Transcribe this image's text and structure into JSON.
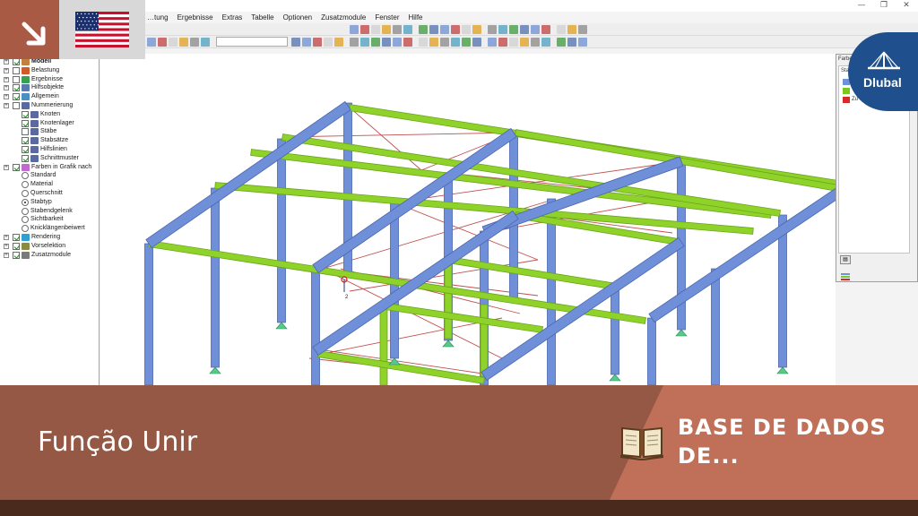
{
  "window": {
    "restore_glyph": "❐",
    "close_glyph": "✕",
    "minimize_glyph": "—"
  },
  "menu": {
    "items": [
      "…tung",
      "Ergebnisse",
      "Extras",
      "Tabelle",
      "Optionen",
      "Zusatzmodule",
      "Fenster",
      "Hilfe"
    ]
  },
  "navigator": {
    "items": [
      {
        "label": "Modell",
        "bold": true,
        "check": "on",
        "icon": "model-icon"
      },
      {
        "label": "Belastung",
        "check": "off",
        "icon": "load-icon"
      },
      {
        "label": "Ergebnisse",
        "check": "off",
        "icon": "results-icon"
      },
      {
        "label": "Hilfsobjekte",
        "check": "on",
        "icon": "guide-objects-icon"
      },
      {
        "label": "Allgemein",
        "check": "on",
        "icon": "general-icon"
      },
      {
        "label": "Nummerierung",
        "check": "off",
        "icon": "numbering-icon"
      },
      {
        "label": "Knoten",
        "check": "on",
        "icon": "numbering-icon"
      },
      {
        "label": "Knotenlager",
        "check": "on",
        "icon": "numbering-icon"
      },
      {
        "label": "Stäbe",
        "check": "off",
        "icon": "numbering-icon"
      },
      {
        "label": "Stabsätze",
        "check": "on",
        "icon": "numbering-icon"
      },
      {
        "label": "Hilfslinien",
        "check": "on",
        "icon": "numbering-icon"
      },
      {
        "label": "Schnittmuster",
        "check": "on",
        "icon": "numbering-icon"
      },
      {
        "label": "Farben in Grafik nach",
        "check": "on",
        "icon": "colors-icon"
      },
      {
        "label": "Standard",
        "radio": "off"
      },
      {
        "label": "Material",
        "radio": "off"
      },
      {
        "label": "Querschnitt",
        "radio": "off"
      },
      {
        "label": "Stabtyp",
        "radio": "on"
      },
      {
        "label": "Stabendgelenk",
        "radio": "off"
      },
      {
        "label": "Sichtbarkeit",
        "radio": "off"
      },
      {
        "label": "Knicklängenbeiwert",
        "radio": "off"
      },
      {
        "label": "Rendering",
        "check": "on",
        "icon": "rendering-icon"
      },
      {
        "label": "Vorselektion",
        "check": "on",
        "icon": "preselection-icon"
      },
      {
        "label": "Zusatzmodule",
        "check": "on",
        "icon": "addon-icon"
      }
    ]
  },
  "panel": {
    "title": "Farbe",
    "header": "Sta",
    "legend": [
      {
        "color": "#6e93d6",
        "label": ""
      },
      {
        "color": "#7dc520",
        "label": ""
      },
      {
        "color": "#d42a2a",
        "label": "Zu"
      }
    ]
  },
  "viewport": {
    "node_label": "2",
    "colors": {
      "frame": "#6f8fd8",
      "frame_dark": "#4a66b0",
      "purlin": "#8fd22a",
      "purlin_dark": "#6aa51a",
      "bracing": "#c05050",
      "support": "#59c98a"
    }
  },
  "badges": {
    "arrow_glyph": "↘",
    "flag_name": "flag-usa-icon",
    "logo_text": "Dlubal"
  },
  "banner": {
    "title": "Função Unir",
    "subtitle": "BASE DE DADOS DE...",
    "icon": "book-icon",
    "colors": {
      "left": "#955845",
      "right": "#c07059",
      "strip": "#4b2a1e"
    }
  }
}
